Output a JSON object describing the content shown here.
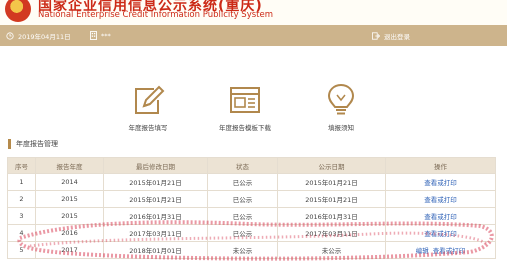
{
  "header": {
    "title_cn": "国家企业信用信息公示系统(重庆)",
    "title_en": "National Enterprise Credit Information Publicity System"
  },
  "nav": {
    "date": "2019年04月11日",
    "user": "***",
    "logout": "退出登录"
  },
  "actions": [
    {
      "icon": "edit-icon",
      "label": "年度报告填写"
    },
    {
      "icon": "report-download-icon",
      "label": "年度报告模板下载"
    },
    {
      "icon": "lightbulb-icon",
      "label": "填报须知"
    }
  ],
  "section": {
    "title": "年度报告管理"
  },
  "table": {
    "headers": [
      "序号",
      "报告年度",
      "最后修改日期",
      "状态",
      "公示日期",
      "操作"
    ],
    "rows": [
      {
        "no": "1",
        "year": "2014",
        "modified": "2015年01月21日",
        "status": "已公示",
        "published": "2015年01月21日",
        "ops": [
          "查看或打印"
        ]
      },
      {
        "no": "2",
        "year": "2015",
        "modified": "2015年01月21日",
        "status": "已公示",
        "published": "2015年01月21日",
        "ops": [
          "查看或打印"
        ]
      },
      {
        "no": "3",
        "year": "2015",
        "modified": "2016年01月31日",
        "status": "已公示",
        "published": "2016年01月31日",
        "ops": [
          "查看或打印"
        ]
      },
      {
        "no": "4",
        "year": "2016",
        "modified": "2017年03月11日",
        "status": "已公示",
        "published": "2017年03月11日",
        "ops": [
          "查看或打印"
        ]
      },
      {
        "no": "5",
        "year": "2017",
        "modified": "2018年01月01日",
        "status": "未公示",
        "published": "未公示",
        "ops": [
          "编辑",
          "查看或打印"
        ]
      }
    ]
  }
}
